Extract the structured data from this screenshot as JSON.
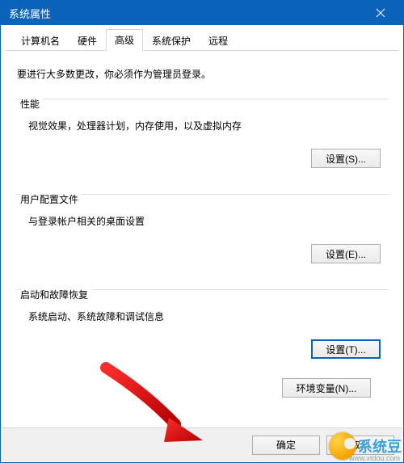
{
  "window": {
    "title": "系统属性"
  },
  "tabs": {
    "t0": "计算机名",
    "t1": "硬件",
    "t2": "高级",
    "t3": "系统保护",
    "t4": "远程"
  },
  "intro": "要进行大多数更改，你必须作为管理员登录。",
  "group_perf": {
    "title": "性能",
    "desc": "视觉效果，处理器计划，内存使用，以及虚拟内存",
    "btn": "设置(S)..."
  },
  "group_profile": {
    "title": "用户配置文件",
    "desc": "与登录帐户相关的桌面设置",
    "btn": "设置(E)..."
  },
  "group_startup": {
    "title": "启动和故障恢复",
    "desc": "系统启动、系统故障和调试信息",
    "btn": "设置(T)..."
  },
  "env_btn": "环境变量(N)...",
  "footer": {
    "ok": "确定",
    "cancel": "取消"
  },
  "watermark": {
    "brand": "系统豆",
    "url": "www.xtdou.com"
  }
}
